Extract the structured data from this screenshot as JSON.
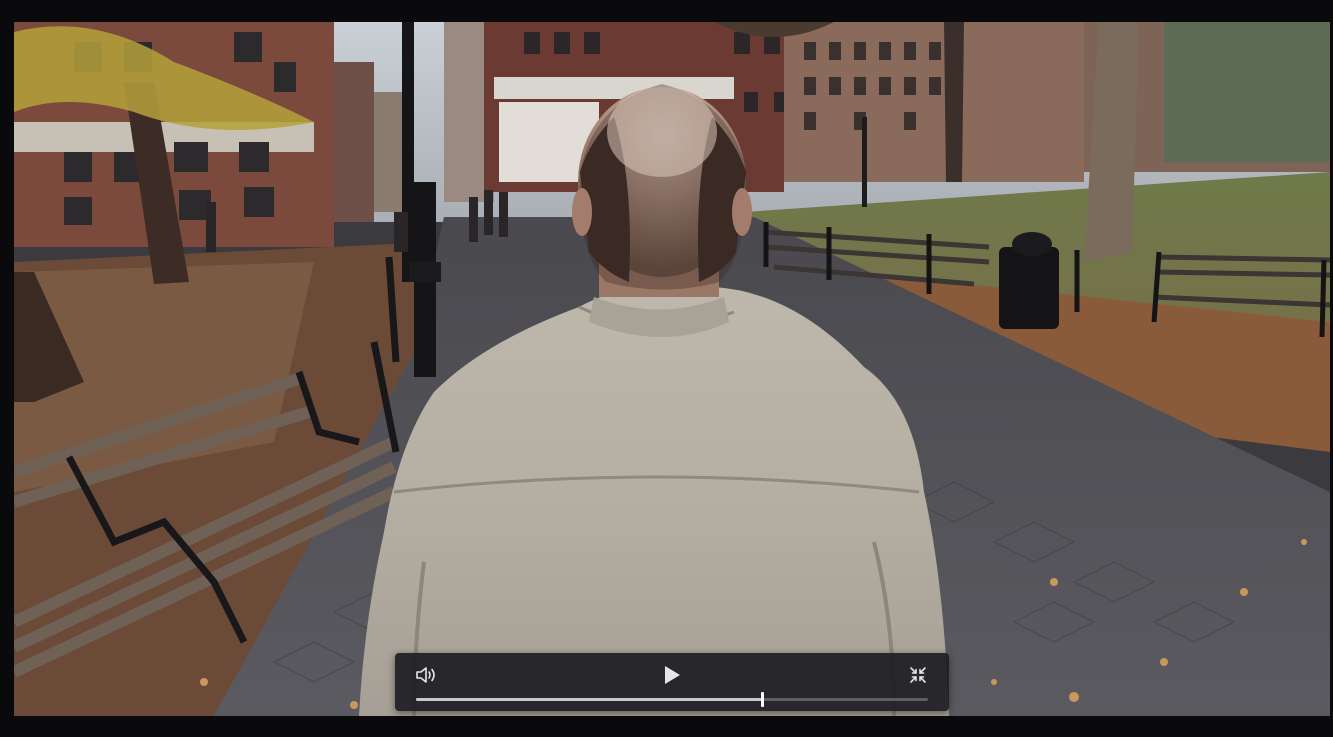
{
  "video": {
    "playback_progress": 0.676,
    "state": "paused"
  },
  "controls": {
    "volume_icon": "speaker-volume-icon",
    "play_icon": "play-icon",
    "exit_fullscreen_icon": "exit-fullscreen-icon"
  },
  "colors": {
    "control_bar_bg": "#1e1e22",
    "track": "#5f5f63",
    "track_fill": "#c9c9cc",
    "thumb": "#ffffff",
    "icon": "#e6e6e8"
  }
}
